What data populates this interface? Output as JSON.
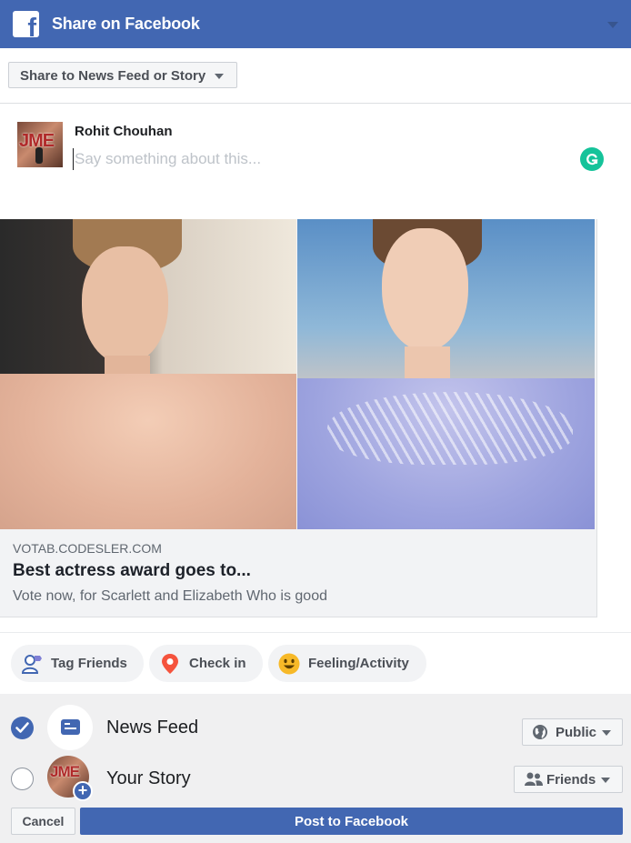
{
  "header": {
    "title": "Share on Facebook",
    "logo_icon": "facebook-f-logo",
    "logo_glyph": "f",
    "brand_color": "#4267b2"
  },
  "destination": {
    "selected": "Share to News Feed or Story"
  },
  "composer": {
    "user_name": "Rohit Chouhan",
    "avatar_text": "JME",
    "placeholder": "Say something about this...",
    "value": "",
    "grammarly_icon": "grammarly-icon"
  },
  "link_card": {
    "domain": "VOTAB.CODESLER.COM",
    "title": "Best actress award goes to...",
    "description": "Vote now, for Scarlett and Elizabeth Who is good"
  },
  "actions": [
    {
      "label": "Tag Friends",
      "icon": "tag-friends-icon"
    },
    {
      "label": "Check in",
      "icon": "location-pin-icon"
    },
    {
      "label": "Feeling/Activity",
      "icon": "smiley-icon"
    }
  ],
  "audience": {
    "news_feed": {
      "label": "News Feed",
      "checked": true,
      "privacy": "Public",
      "privacy_icon": "globe-icon"
    },
    "story": {
      "label": "Your Story",
      "checked": false,
      "privacy": "Friends",
      "privacy_icon": "friends-icon",
      "avatar_text": "JME",
      "plus": "+"
    }
  },
  "footer": {
    "cancel_label": "Cancel",
    "post_label": "Post to Facebook"
  }
}
